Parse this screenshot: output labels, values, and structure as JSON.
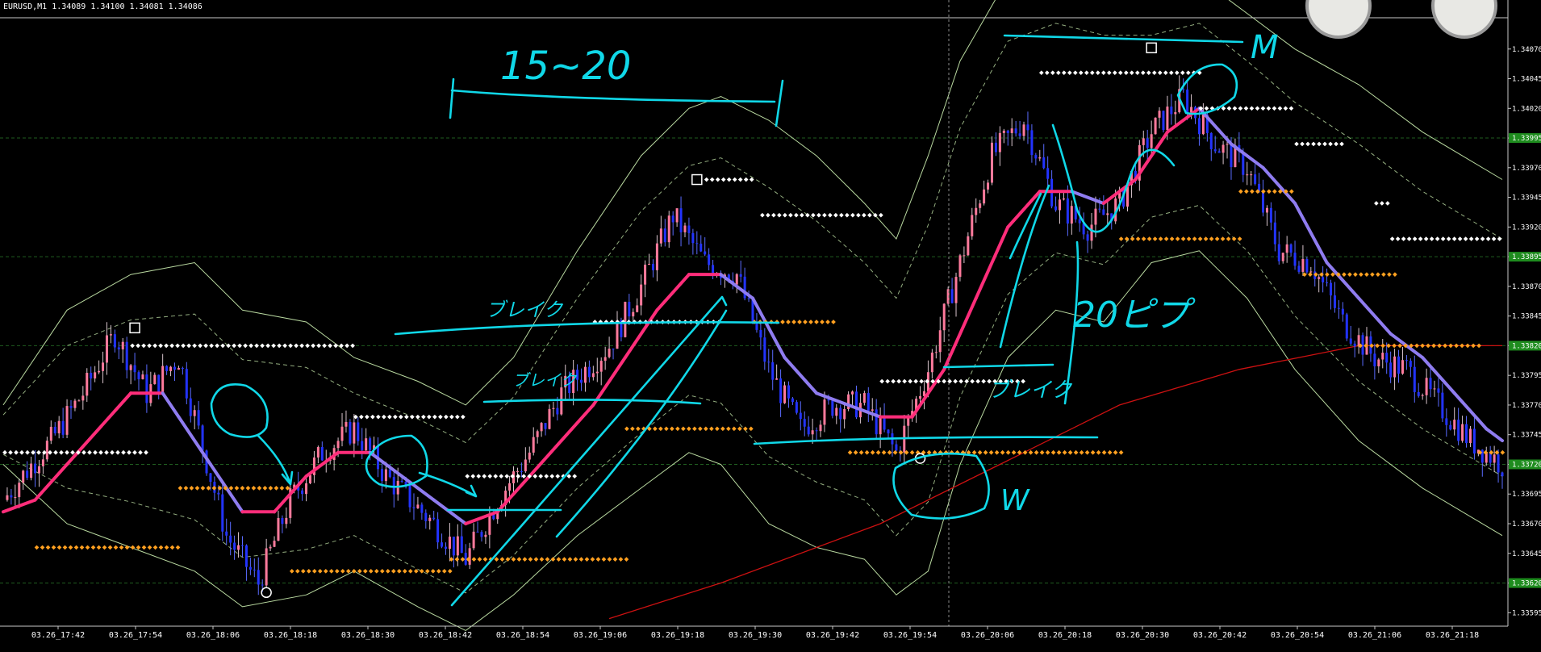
{
  "header": {
    "symbol": "EURUSD,M1",
    "open": "1.34089",
    "high": "1.34100",
    "low": "1.34081",
    "close": "1.34086"
  },
  "annotations": {
    "range_note": "15~20",
    "break_1": "ブレイク",
    "break_2": "ブレイク",
    "break_3": "ブレイク",
    "pips_note": "20ピプ",
    "m_pattern": "M",
    "w_pattern": "W"
  },
  "colors": {
    "background": "#000000",
    "bull_candle": "#ff7a9c",
    "bear_candle": "#2233ff",
    "ma_up": "#ff2d7a",
    "ma_down": "#8f7cf0",
    "long_ma": "#cc1111",
    "bands": "#b9d9a0",
    "white_dots": "#ffffff",
    "orange_dots": "#ffa020",
    "handwriting": "#10d8e8",
    "price_tag": "#1e8c1e",
    "grid": "#1f5c1f"
  },
  "chart_data": {
    "type": "line",
    "title": "EURUSD,M1",
    "xlabel": "",
    "ylabel": "",
    "ylim": [
      1.33585,
      1.34095
    ],
    "ytick_labels": [
      "1.34070",
      "1.34045",
      "1.34020",
      "1.33995",
      "1.33970",
      "1.33945",
      "1.33920",
      "1.33895",
      "1.33870",
      "1.33845",
      "1.33820",
      "1.33795",
      "1.33770",
      "1.33745",
      "1.33720",
      "1.33695",
      "1.33670",
      "1.33645",
      "1.33620",
      "1.33595"
    ],
    "price_tags": [
      "1.33995",
      "1.33895",
      "1.33820",
      "1.33720",
      "1.33620"
    ],
    "xtick_labels": [
      "03.26_17:42",
      "03.26_17:54",
      "03.26_18:06",
      "03.26_18:18",
      "03.26_18:30",
      "03.26_18:42",
      "03.26_18:54",
      "03.26_19:06",
      "03.26_19:18",
      "03.26_19:30",
      "03.26_19:42",
      "03.26_19:54",
      "03.26_20:06",
      "03.26_20:18",
      "03.26_20:30",
      "03.26_20:42",
      "03.26_20:54",
      "03.26_21:06",
      "03.26_21:18"
    ],
    "price_path": [
      [
        0,
        1.3369
      ],
      [
        6,
        1.3374
      ],
      [
        10,
        1.3378
      ],
      [
        14,
        1.3383
      ],
      [
        18,
        1.3378
      ],
      [
        22,
        1.3381
      ],
      [
        24,
        1.3376
      ],
      [
        28,
        1.3366
      ],
      [
        32,
        1.3362
      ],
      [
        36,
        1.3369
      ],
      [
        40,
        1.3373
      ],
      [
        44,
        1.3375
      ],
      [
        48,
        1.3371
      ],
      [
        54,
        1.3367
      ],
      [
        58,
        1.3364
      ],
      [
        62,
        1.3369
      ],
      [
        66,
        1.3373
      ],
      [
        70,
        1.3378
      ],
      [
        76,
        1.3382
      ],
      [
        80,
        1.3387
      ],
      [
        84,
        1.3393
      ],
      [
        88,
        1.3389
      ],
      [
        92,
        1.3388
      ],
      [
        96,
        1.338
      ],
      [
        100,
        1.3375
      ],
      [
        104,
        1.3377
      ],
      [
        108,
        1.3377
      ],
      [
        112,
        1.3373
      ],
      [
        116,
        1.338
      ],
      [
        120,
        1.3389
      ],
      [
        124,
        1.3398
      ],
      [
        128,
        1.3401
      ],
      [
        132,
        1.3394
      ],
      [
        136,
        1.3392
      ],
      [
        140,
        1.3394
      ],
      [
        144,
        1.34
      ],
      [
        148,
        1.3403
      ],
      [
        152,
        1.3399
      ],
      [
        156,
        1.3397
      ],
      [
        160,
        1.339
      ],
      [
        164,
        1.3389
      ],
      [
        168,
        1.3384
      ],
      [
        172,
        1.3381
      ],
      [
        176,
        1.338
      ],
      [
        180,
        1.3377
      ],
      [
        184,
        1.3374
      ],
      [
        188,
        1.3372
      ]
    ],
    "series": [
      {
        "name": "",
        "kind": "fast_ma",
        "values": [
          [
            0,
            1.3368
          ],
          [
            4,
            1.3369
          ],
          [
            8,
            1.3372
          ],
          [
            12,
            1.3375
          ],
          [
            16,
            1.3378
          ],
          [
            20,
            1.3378
          ],
          [
            22,
            1.3376
          ],
          [
            26,
            1.3372
          ],
          [
            30,
            1.3368
          ],
          [
            34,
            1.3368
          ],
          [
            38,
            1.3371
          ],
          [
            42,
            1.3373
          ],
          [
            46,
            1.3373
          ],
          [
            50,
            1.3371
          ],
          [
            54,
            1.3369
          ],
          [
            58,
            1.3367
          ],
          [
            62,
            1.3368
          ],
          [
            66,
            1.3371
          ],
          [
            70,
            1.3374
          ],
          [
            74,
            1.3377
          ],
          [
            78,
            1.3381
          ],
          [
            82,
            1.3385
          ],
          [
            86,
            1.3388
          ],
          [
            90,
            1.3388
          ],
          [
            94,
            1.3386
          ],
          [
            98,
            1.3381
          ],
          [
            102,
            1.3378
          ],
          [
            106,
            1.3377
          ],
          [
            110,
            1.3376
          ],
          [
            114,
            1.3376
          ],
          [
            118,
            1.338
          ],
          [
            122,
            1.3386
          ],
          [
            126,
            1.3392
          ],
          [
            130,
            1.3395
          ],
          [
            134,
            1.3395
          ],
          [
            138,
            1.3394
          ],
          [
            142,
            1.3396
          ],
          [
            146,
            1.34
          ],
          [
            150,
            1.3402
          ],
          [
            154,
            1.3399
          ],
          [
            158,
            1.3397
          ],
          [
            162,
            1.3394
          ],
          [
            166,
            1.3389
          ],
          [
            170,
            1.3386
          ],
          [
            174,
            1.3383
          ],
          [
            178,
            1.3381
          ],
          [
            182,
            1.3378
          ],
          [
            186,
            1.3375
          ],
          [
            188,
            1.3374
          ]
        ]
      },
      {
        "name": "",
        "kind": "long_ma",
        "values": [
          [
            76,
            1.3359
          ],
          [
            90,
            1.3362
          ],
          [
            110,
            1.3367
          ],
          [
            125,
            1.3372
          ],
          [
            140,
            1.3377
          ],
          [
            155,
            1.338
          ],
          [
            170,
            1.3382
          ],
          [
            188,
            1.3382
          ]
        ]
      },
      {
        "name": "",
        "kind": "band_upper",
        "values": [
          [
            0,
            1.3377
          ],
          [
            8,
            1.3385
          ],
          [
            16,
            1.3388
          ],
          [
            24,
            1.3389
          ],
          [
            30,
            1.3385
          ],
          [
            38,
            1.3384
          ],
          [
            44,
            1.3381
          ],
          [
            52,
            1.3379
          ],
          [
            58,
            1.3377
          ],
          [
            64,
            1.3381
          ],
          [
            72,
            1.339
          ],
          [
            80,
            1.3398
          ],
          [
            86,
            1.3402
          ],
          [
            90,
            1.3403
          ],
          [
            96,
            1.3401
          ],
          [
            102,
            1.3398
          ],
          [
            108,
            1.3394
          ],
          [
            112,
            1.3391
          ],
          [
            116,
            1.3398
          ],
          [
            120,
            1.3406
          ],
          [
            126,
            1.3413
          ],
          [
            132,
            1.3414
          ],
          [
            138,
            1.3413
          ],
          [
            144,
            1.3412
          ],
          [
            150,
            1.3413
          ],
          [
            156,
            1.341
          ],
          [
            162,
            1.3407
          ],
          [
            170,
            1.3404
          ],
          [
            178,
            1.34
          ],
          [
            188,
            1.3396
          ]
        ]
      },
      {
        "name": "",
        "kind": "band_lower",
        "values": [
          [
            0,
            1.3372
          ],
          [
            8,
            1.3367
          ],
          [
            16,
            1.3365
          ],
          [
            24,
            1.3363
          ],
          [
            30,
            1.336
          ],
          [
            38,
            1.3361
          ],
          [
            44,
            1.3363
          ],
          [
            52,
            1.336
          ],
          [
            58,
            1.3358
          ],
          [
            64,
            1.3361
          ],
          [
            72,
            1.3366
          ],
          [
            80,
            1.337
          ],
          [
            86,
            1.3373
          ],
          [
            90,
            1.3372
          ],
          [
            96,
            1.3367
          ],
          [
            102,
            1.3365
          ],
          [
            108,
            1.3364
          ],
          [
            112,
            1.3361
          ],
          [
            116,
            1.3363
          ],
          [
            120,
            1.3372
          ],
          [
            126,
            1.3381
          ],
          [
            132,
            1.3385
          ],
          [
            138,
            1.3384
          ],
          [
            144,
            1.3389
          ],
          [
            150,
            1.339
          ],
          [
            156,
            1.3386
          ],
          [
            162,
            1.338
          ],
          [
            170,
            1.3374
          ],
          [
            178,
            1.337
          ],
          [
            188,
            1.3366
          ]
        ]
      }
    ],
    "white_levels": [
      {
        "x1": 0,
        "x2": 18,
        "y": 1.3373
      },
      {
        "x1": 16,
        "x2": 44,
        "y": 1.3382
      },
      {
        "x1": 44,
        "x2": 58,
        "y": 1.3376
      },
      {
        "x1": 58,
        "x2": 72,
        "y": 1.3371
      },
      {
        "x1": 74,
        "x2": 90,
        "y": 1.3384
      },
      {
        "x1": 88,
        "x2": 94,
        "y": 1.3396
      },
      {
        "x1": 95,
        "x2": 110,
        "y": 1.3393
      },
      {
        "x1": 110,
        "x2": 128,
        "y": 1.3379
      },
      {
        "x1": 130,
        "x2": 150,
        "y": 1.3405
      },
      {
        "x1": 150,
        "x2": 162,
        "y": 1.3402
      },
      {
        "x1": 162,
        "x2": 168,
        "y": 1.3399
      },
      {
        "x1": 172,
        "x2": 174,
        "y": 1.3394
      },
      {
        "x1": 174,
        "x2": 188,
        "y": 1.3391
      }
    ],
    "orange_levels": [
      {
        "x1": 4,
        "x2": 22,
        "y": 1.3365
      },
      {
        "x1": 22,
        "x2": 36,
        "y": 1.337
      },
      {
        "x1": 36,
        "x2": 56,
        "y": 1.3363
      },
      {
        "x1": 56,
        "x2": 78,
        "y": 1.3364
      },
      {
        "x1": 78,
        "x2": 94,
        "y": 1.3375
      },
      {
        "x1": 94,
        "x2": 104,
        "y": 1.3384
      },
      {
        "x1": 106,
        "x2": 140,
        "y": 1.3373
      },
      {
        "x1": 140,
        "x2": 155,
        "y": 1.3391
      },
      {
        "x1": 155,
        "x2": 162,
        "y": 1.3395
      },
      {
        "x1": 163,
        "x2": 175,
        "y": 1.3388
      },
      {
        "x1": 170,
        "x2": 185,
        "y": 1.3382
      },
      {
        "x1": 185,
        "x2": 188,
        "y": 1.3373
      }
    ],
    "fractals": [
      {
        "x": 16.5,
        "y": 1.33835,
        "shape": "square"
      },
      {
        "x": 33,
        "y": 1.33612,
        "shape": "circle"
      },
      {
        "x": 87,
        "y": 1.3396,
        "shape": "square"
      },
      {
        "x": 115,
        "y": 1.33725,
        "shape": "circle"
      },
      {
        "x": 144,
        "y": 1.34071,
        "shape": "square"
      }
    ],
    "grid": false,
    "legend": "none"
  }
}
